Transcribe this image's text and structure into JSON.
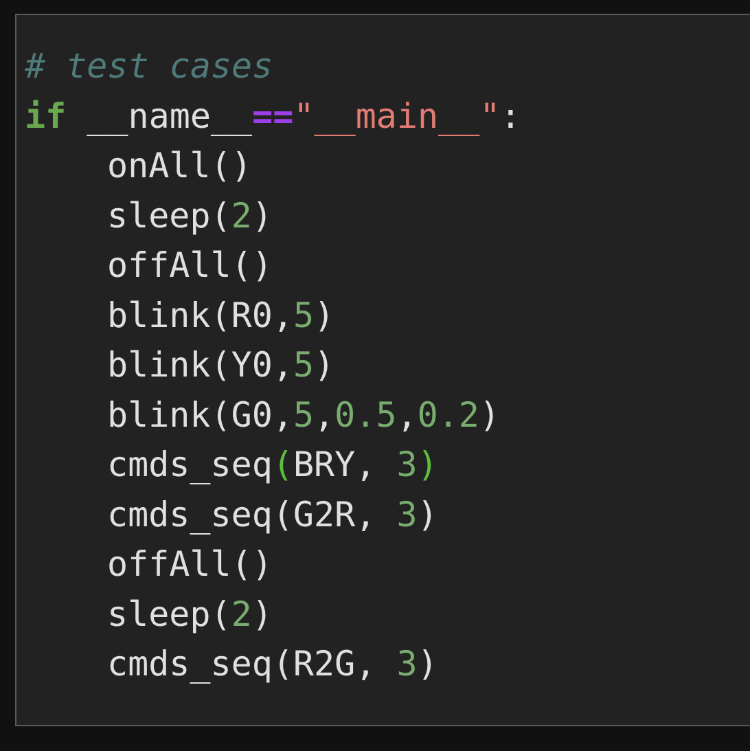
{
  "lines": [
    {
      "tokens": [
        {
          "t": "# test cases",
          "c": "comment"
        }
      ]
    },
    {
      "tokens": [
        {
          "t": "if",
          "c": "kw"
        },
        {
          "t": " __name__",
          "c": ""
        },
        {
          "t": "==",
          "c": "op"
        },
        {
          "t": "\"",
          "c": "str-q"
        },
        {
          "t": "__main__",
          "c": "str"
        },
        {
          "t": "\"",
          "c": "str-q"
        },
        {
          "t": ":",
          "c": ""
        }
      ]
    },
    {
      "indent": true,
      "tokens": [
        {
          "t": "onAll()",
          "c": ""
        }
      ]
    },
    {
      "indent": true,
      "tokens": [
        {
          "t": "sleep(",
          "c": ""
        },
        {
          "t": "2",
          "c": "num"
        },
        {
          "t": ")",
          "c": ""
        }
      ]
    },
    {
      "indent": true,
      "tokens": [
        {
          "t": "offAll()",
          "c": ""
        }
      ]
    },
    {
      "indent": true,
      "tokens": [
        {
          "t": "blink(R0,",
          "c": ""
        },
        {
          "t": "5",
          "c": "num"
        },
        {
          "t": ")",
          "c": ""
        }
      ]
    },
    {
      "indent": true,
      "tokens": [
        {
          "t": "blink(Y0,",
          "c": ""
        },
        {
          "t": "5",
          "c": "num"
        },
        {
          "t": ")",
          "c": ""
        }
      ]
    },
    {
      "indent": true,
      "tokens": [
        {
          "t": "blink(G0,",
          "c": ""
        },
        {
          "t": "5",
          "c": "num"
        },
        {
          "t": ",",
          "c": ""
        },
        {
          "t": "0.5",
          "c": "num"
        },
        {
          "t": ",",
          "c": ""
        },
        {
          "t": "0.2",
          "c": "num"
        },
        {
          "t": ")",
          "c": ""
        }
      ]
    },
    {
      "indent": true,
      "tokens": [
        {
          "t": "cmds_seq",
          "c": ""
        },
        {
          "t": "(",
          "c": "pg"
        },
        {
          "t": "BRY, ",
          "c": ""
        },
        {
          "t": "3",
          "c": "num"
        },
        {
          "t": ")",
          "c": "pg"
        }
      ]
    },
    {
      "indent": true,
      "tokens": [
        {
          "t": "cmds_seq(G2R, ",
          "c": ""
        },
        {
          "t": "3",
          "c": "num"
        },
        {
          "t": ")",
          "c": ""
        }
      ]
    },
    {
      "indent": true,
      "tokens": [
        {
          "t": "offAll()",
          "c": ""
        }
      ]
    },
    {
      "indent": true,
      "tokens": [
        {
          "t": "sleep(",
          "c": ""
        },
        {
          "t": "2",
          "c": "num"
        },
        {
          "t": ")",
          "c": ""
        }
      ]
    },
    {
      "indent": true,
      "tokens": [
        {
          "t": "cmds_seq(R2G, ",
          "c": ""
        },
        {
          "t": "3",
          "c": "num"
        },
        {
          "t": ")",
          "c": ""
        }
      ]
    }
  ],
  "colors": {
    "background": "#222222",
    "comment": "#507a7a",
    "keyword": "#6aa84f",
    "operator": "#9d3fe6",
    "string": "#e37d74",
    "number": "#79ac6f",
    "text": "#e0e0e0"
  }
}
